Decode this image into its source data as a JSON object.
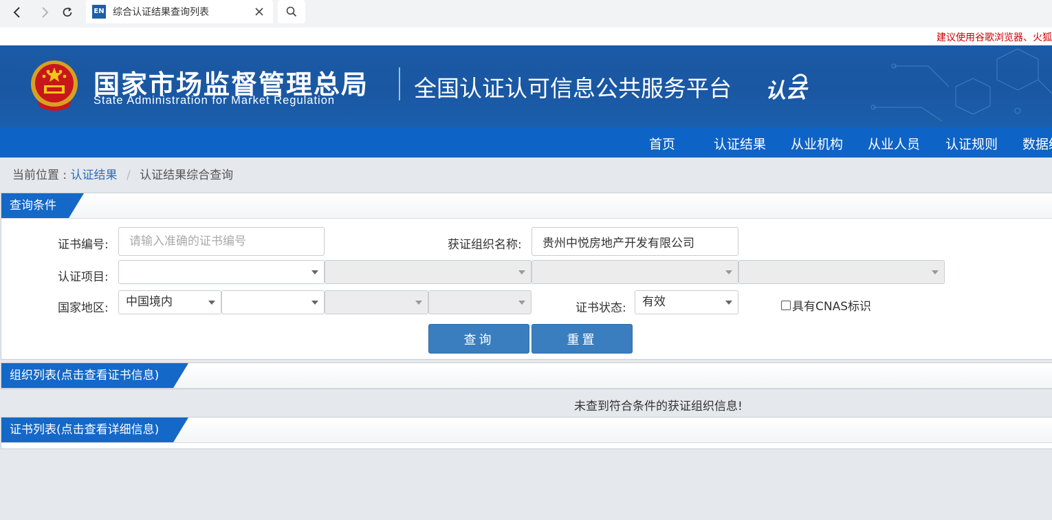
{
  "browser": {
    "tab_title": "综合认证结果查询列表",
    "favicon_text": "EN"
  },
  "notice": "建议使用谷歌浏览器、火狐",
  "header": {
    "agency_cn": "国家市场监督管理总局",
    "agency_en": "State Administration  for  Market Regulation",
    "platform_title": "全国认证认可信息公共服务平台",
    "logo_text": "认云"
  },
  "nav": {
    "items": [
      "首页",
      "认证结果",
      "从业机构",
      "从业人员",
      "认证规则",
      "数据统"
    ]
  },
  "breadcrumb": {
    "prefix": "当前位置 :",
    "link": "认证结果",
    "separator": "/",
    "current": "认证结果综合查询"
  },
  "query_panel": {
    "title": "查询条件",
    "cert_no_label": "证书编号:",
    "cert_no_placeholder": "请输入准确的证书编号",
    "org_name_label": "获证组织名称:",
    "org_name_value": "贵州中悦房地产开发有限公司",
    "project_label": "认证项目:",
    "region_label": "国家地区:",
    "region_value": "中国境内",
    "status_label": "证书状态:",
    "status_value": "有效",
    "cnas_label": "具有CNAS标识",
    "search_button": "查询",
    "reset_button": "重置"
  },
  "org_panel": {
    "title": "组织列表(点击查看证书信息)",
    "empty_message": "未查到符合条件的获证组织信息!"
  },
  "cert_panel": {
    "title": "证书列表(点击查看详细信息)"
  },
  "colors": {
    "banner_blue": "#1b5aa6",
    "nav_blue": "#0e63c6",
    "tag_blue": "#1468c8",
    "button_blue": "#3a7ebf",
    "notice_red": "#cc0000",
    "page_bg": "#e5e8ec"
  },
  "icons": [
    "back-arrow-icon",
    "forward-arrow-icon",
    "reload-icon",
    "close-icon",
    "search-icon",
    "national-emblem-icon",
    "caret-down-icon",
    "checkbox-icon"
  ]
}
